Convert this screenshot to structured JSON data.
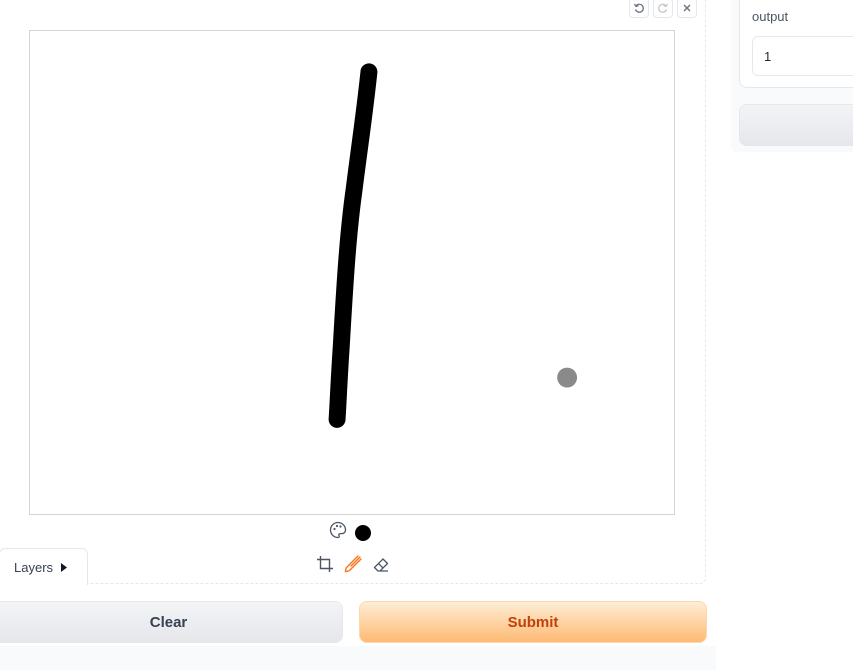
{
  "toolbar": {
    "undo_icon": "undo-icon",
    "redo_icon": "redo-icon",
    "close_icon": "close-icon"
  },
  "canvas": {
    "stroke_color": "#000000",
    "cursor_color": "#8a8a8a"
  },
  "color_picker": {
    "palette_icon": "palette-icon",
    "selected_color": "#000000"
  },
  "tools": {
    "crop_icon": "crop-icon",
    "brush_icon": "brush-icon",
    "eraser_icon": "eraser-icon",
    "active_color": "#f97316"
  },
  "layers": {
    "label": "Layers",
    "icon": "caret-right-icon"
  },
  "actions": {
    "clear_label": "Clear",
    "submit_label": "Submit"
  },
  "output": {
    "label": "output",
    "value": "1"
  }
}
